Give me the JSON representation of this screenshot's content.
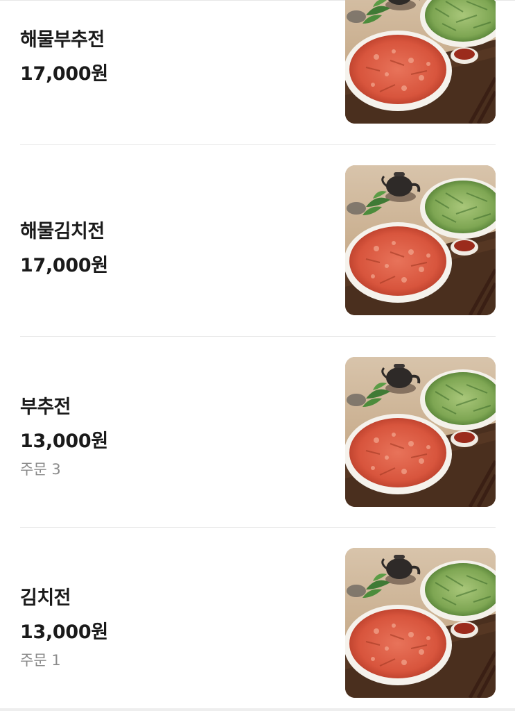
{
  "menu_items": [
    {
      "name": "해물부추전",
      "price": "17,000원",
      "orders": ""
    },
    {
      "name": "해물김치전",
      "price": "17,000원",
      "orders": ""
    },
    {
      "name": "부추전",
      "price": "13,000원",
      "orders": "주문 3"
    },
    {
      "name": "김치전",
      "price": "13,000원",
      "orders": "주문 1"
    }
  ],
  "colors": {
    "text_primary": "#1a1a1a",
    "text_secondary": "#8a8a8a",
    "divider": "#e8e8e8"
  }
}
